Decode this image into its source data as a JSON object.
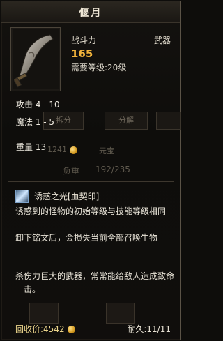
{
  "item": {
    "name": "偃月",
    "power_label": "战斗力",
    "power_value": "165",
    "type": "武器",
    "level_req": "需要等级:20级",
    "icon": "crescent-blade-icon"
  },
  "stats": {
    "attack": "攻击 4 - 10",
    "magic": "魔法 1 - 5",
    "weight": "重量 13"
  },
  "background_ui": {
    "split_button": "拆分",
    "decompose_button": "分解",
    "gold_amount": "1241",
    "yuanbao_label": "元宝",
    "load_label": "负重",
    "load_value": "192/235"
  },
  "inscription": {
    "icon": "sparkle-skill-icon",
    "name": "诱惑之光[血契印]",
    "desc_line1": "诱惑到的怪物的初始等级与技能等级相同",
    "desc_line2": "卸下铭文后，会损失当前全部召唤生物"
  },
  "flavor": "杀伤力巨大的武器，常常能给敌人造成致命一击。",
  "footer": {
    "recycle_label": "回收价:4542",
    "durability": "耐久:11/11"
  },
  "colors": {
    "power": "#f1b33b",
    "text": "#e6e1d6",
    "border": "#5a5246"
  }
}
